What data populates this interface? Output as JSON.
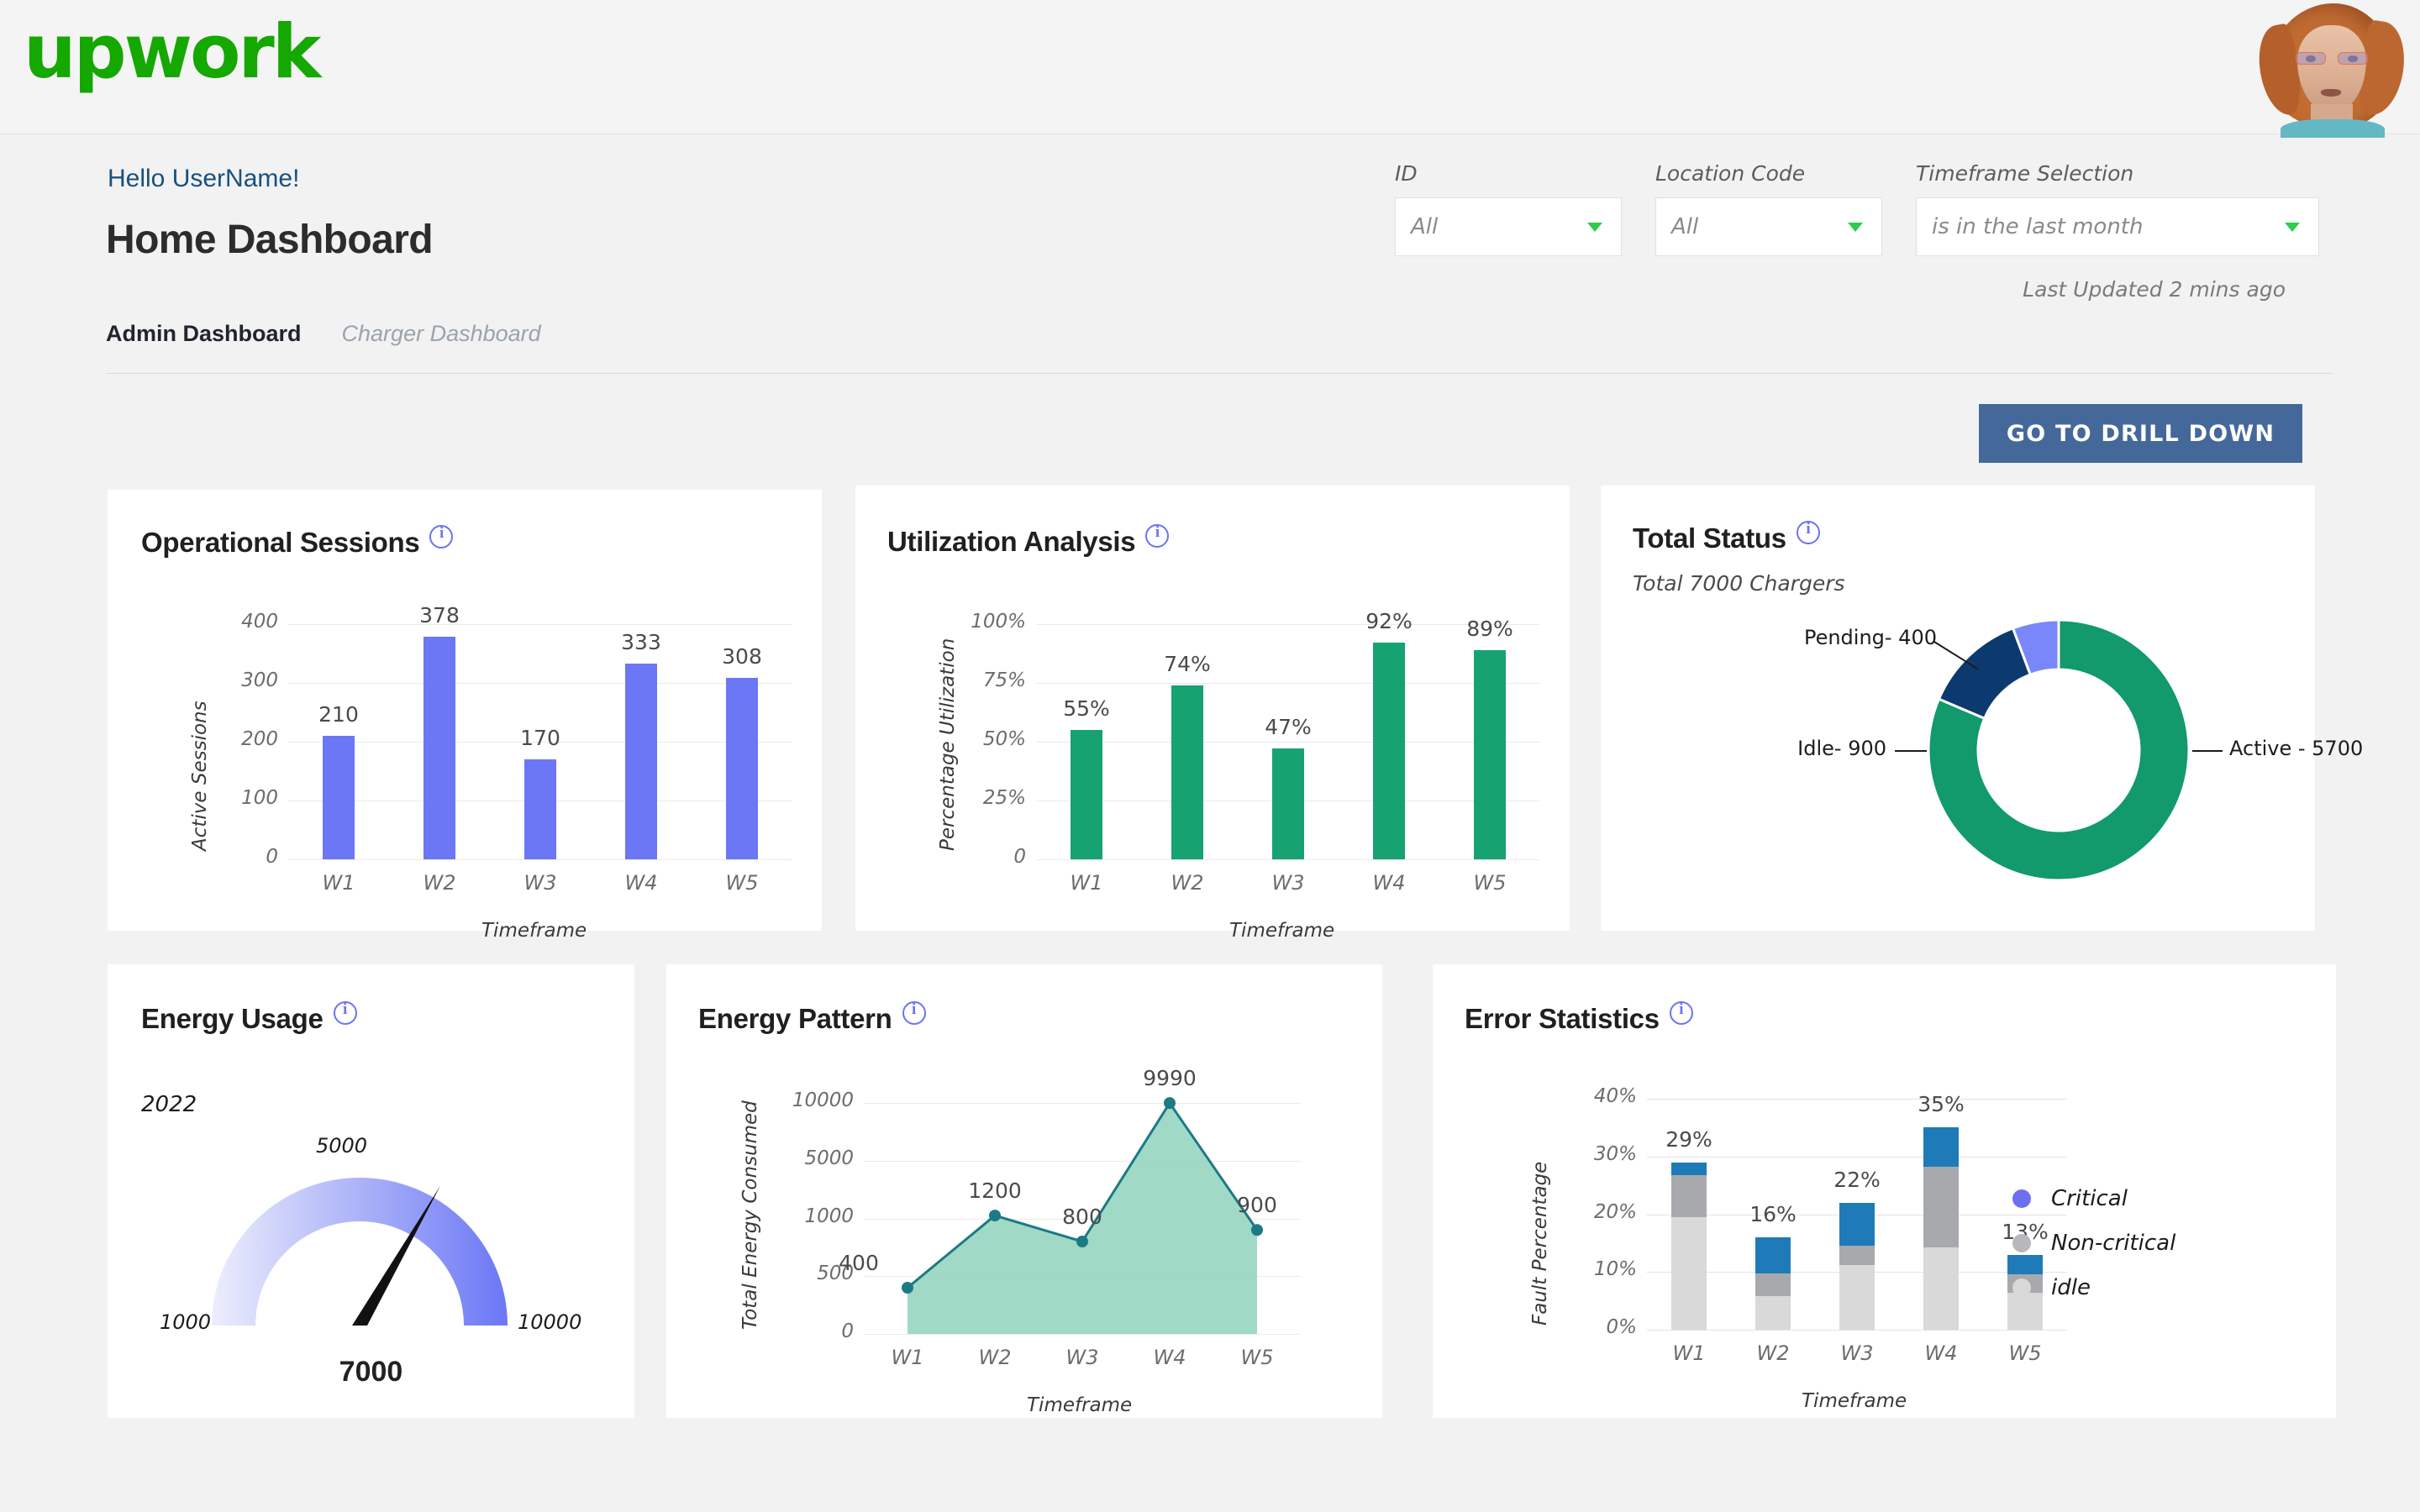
{
  "brand": {
    "logo_text": "upwork",
    "logo_color": "#14a800"
  },
  "header": {
    "greeting": "Hello UserName!",
    "title": "Home Dashboard",
    "tabs": [
      {
        "label": "Admin Dashboard",
        "active": true
      },
      {
        "label": "Charger Dashboard",
        "active": false
      }
    ]
  },
  "filters": {
    "id": {
      "label": "ID",
      "value": "All"
    },
    "location": {
      "label": "Location  Code",
      "value": "All"
    },
    "timeframe": {
      "label": "Timeframe Selection",
      "value": "is in the last month"
    },
    "last_updated": "Last Updated 2 mins ago"
  },
  "actions": {
    "drill_down_label": "GO TO DRILL DOWN",
    "drill_down_color": "#44689a"
  },
  "cards": {
    "operational_sessions": {
      "title": "Operational Sessions"
    },
    "utilization_analysis": {
      "title": "Utilization Analysis"
    },
    "total_status": {
      "title": "Total Status",
      "subtitle": "Total 7000 Chargers"
    },
    "energy_usage": {
      "title": "Energy Usage"
    },
    "energy_pattern": {
      "title": "Energy Pattern"
    },
    "error_statistics": {
      "title": "Error Statistics"
    }
  },
  "chart_data": [
    {
      "id": "operational_sessions",
      "type": "bar",
      "title": "Operational Sessions",
      "categories": [
        "W1",
        "W2",
        "W3",
        "W4",
        "W5"
      ],
      "values": [
        210,
        378,
        170,
        333,
        308
      ],
      "value_labels": [
        "210",
        "378",
        "170",
        "333",
        "308"
      ],
      "xlabel": "Timeframe",
      "ylabel": "Active Sessions",
      "yticks": [
        "0",
        "100",
        "200",
        "300",
        "400"
      ],
      "ylim": [
        0,
        400
      ],
      "grid": true,
      "color": "#6b77f5"
    },
    {
      "id": "utilization_analysis",
      "type": "bar",
      "title": "Utilization Analysis",
      "categories": [
        "W1",
        "W2",
        "W3",
        "W4",
        "W5"
      ],
      "values": [
        55,
        74,
        47,
        92,
        89
      ],
      "value_labels": [
        "55%",
        "74%",
        "47%",
        "92%",
        "89%"
      ],
      "xlabel": "Timeframe",
      "ylabel": "Percentage Utilization",
      "yticks": [
        "0",
        "25%",
        "50%",
        "75%",
        "100%"
      ],
      "ylim": [
        0,
        100
      ],
      "grid": true,
      "color": "#17a272"
    },
    {
      "id": "total_status",
      "type": "pie",
      "title": "Total Status",
      "subtitle": "Total 7000 Chargers",
      "total": 7000,
      "slices": [
        {
          "label": "Active - 5700",
          "name": "Active",
          "value": 5700,
          "color": "#12996c"
        },
        {
          "label": "Idle- 900",
          "name": "Idle",
          "value": 900,
          "color": "#0c3a6e"
        },
        {
          "label": "Pending- 400",
          "name": "Pending",
          "value": 400,
          "color": "#7a87fa"
        }
      ],
      "legend": "callout-labels"
    },
    {
      "id": "energy_usage",
      "type": "gauge",
      "title": "Energy Usage",
      "year": "2022",
      "min_label": "1000",
      "mid_label": "5000",
      "max_label": "10000",
      "min": 1000,
      "max": 10000,
      "value": 7000,
      "value_label": "7000",
      "gradient_from": "#eceefc",
      "gradient_to": "#6b77f5"
    },
    {
      "id": "energy_pattern",
      "type": "area",
      "title": "Energy Pattern",
      "categories": [
        "W1",
        "W2",
        "W3",
        "W4",
        "W5"
      ],
      "values": [
        400,
        1200,
        800,
        9990,
        900
      ],
      "value_labels": [
        "400",
        "1200",
        "800",
        "9990",
        "900"
      ],
      "xlabel": "Timeframe",
      "ylabel": "Total Energy Consumed",
      "yticks": [
        "0",
        "500",
        "1000",
        "5000",
        "10000"
      ],
      "grid": true,
      "line_color": "#1c7a85",
      "fill_color": "#96d6c0"
    },
    {
      "id": "error_statistics",
      "type": "bar",
      "stacked": true,
      "title": "Error Statistics",
      "categories": [
        "W1",
        "W2",
        "W3",
        "W4",
        "W5"
      ],
      "totals": [
        29,
        16,
        22,
        35,
        13
      ],
      "total_labels": [
        "29%",
        "16%",
        "22%",
        "35%",
        "13%"
      ],
      "series": [
        {
          "name": "idle",
          "values": [
            19.5,
            5.8,
            11.2,
            14.2,
            6.4
          ],
          "color": "#d9d9d9"
        },
        {
          "name": "Non-critical",
          "values": [
            7.3,
            4.0,
            3.4,
            14.0,
            3.2
          ],
          "color": "#a8a9ad"
        },
        {
          "name": "Critical",
          "values": [
            2.2,
            6.2,
            7.4,
            6.8,
            3.4
          ],
          "color": "#1f7bb8"
        }
      ],
      "xlabel": "Timeframe",
      "ylabel": "Fault  Percentage",
      "yticks": [
        "0%",
        "10%",
        "20%",
        "30%",
        "40%"
      ],
      "ylim": [
        0,
        40
      ],
      "grid": true,
      "legend_items": [
        {
          "label": "Critical",
          "dot_color": "#6c70f0"
        },
        {
          "label": "Non-critical",
          "dot_color": "#b6b8bd"
        },
        {
          "label": "idle",
          "dot_color": "#d9d9d9"
        }
      ],
      "legend_position": "right"
    }
  ]
}
